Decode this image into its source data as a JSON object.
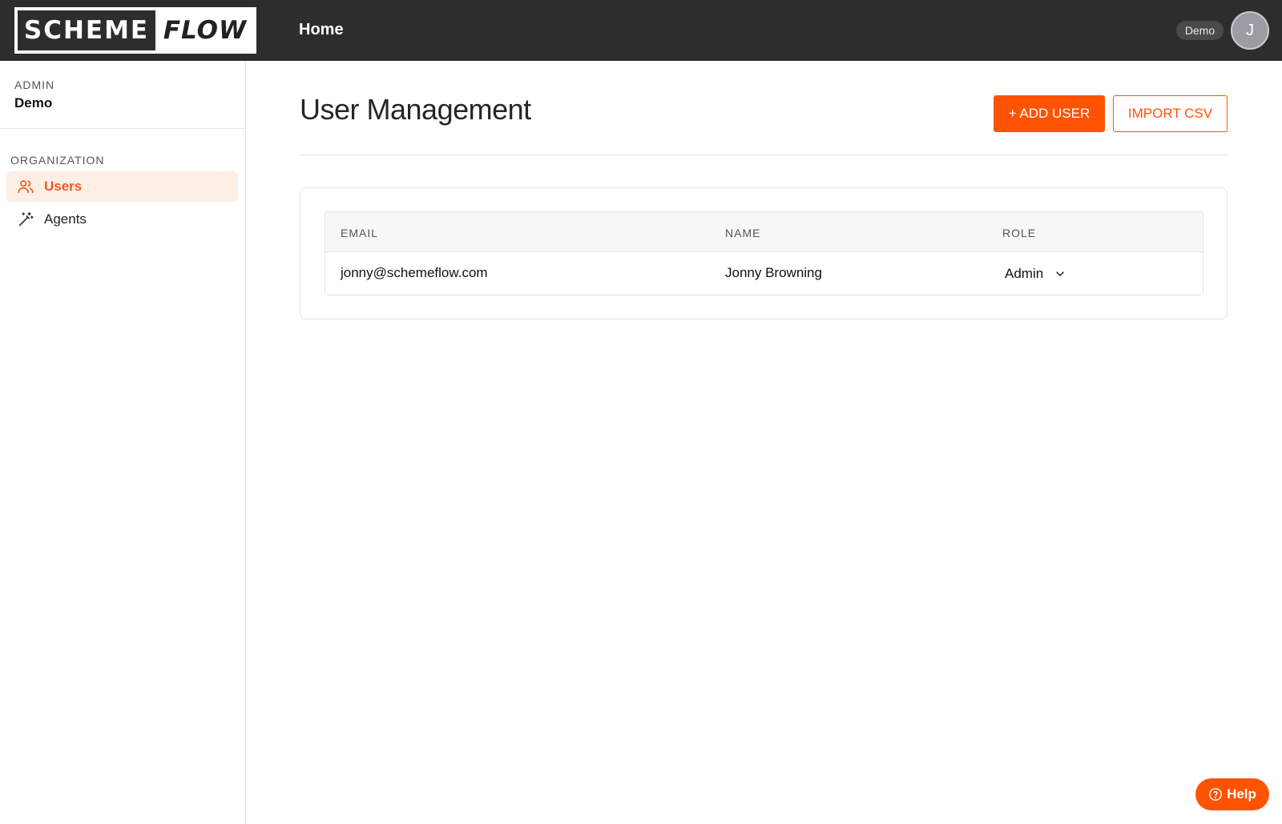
{
  "brand": {
    "logo_part1": "SCHEME",
    "logo_part2": "FLOW"
  },
  "topbar": {
    "nav_home": "Home",
    "org_badge": "Demo",
    "avatar_initial": "J"
  },
  "sidebar": {
    "admin_label": "ADMIN",
    "admin_name": "Demo",
    "section_label": "ORGANIZATION",
    "items": [
      {
        "label": "Users",
        "icon": "users-icon",
        "active": true
      },
      {
        "label": "Agents",
        "icon": "magic-wand-icon",
        "active": false
      }
    ]
  },
  "main": {
    "title": "User Management",
    "add_user_label": "+ ADD USER",
    "import_csv_label": "IMPORT CSV",
    "table": {
      "columns": [
        "EMAIL",
        "NAME",
        "ROLE"
      ],
      "rows": [
        {
          "email": "jonny@schemeflow.com",
          "name": "Jonny Browning",
          "role": "Admin"
        }
      ]
    }
  },
  "help": {
    "label": "Help",
    "icon": "question-circle-icon"
  },
  "colors": {
    "accent": "#ff5304",
    "topbar": "#2e2d2e",
    "active_bg": "#fdeee6"
  }
}
